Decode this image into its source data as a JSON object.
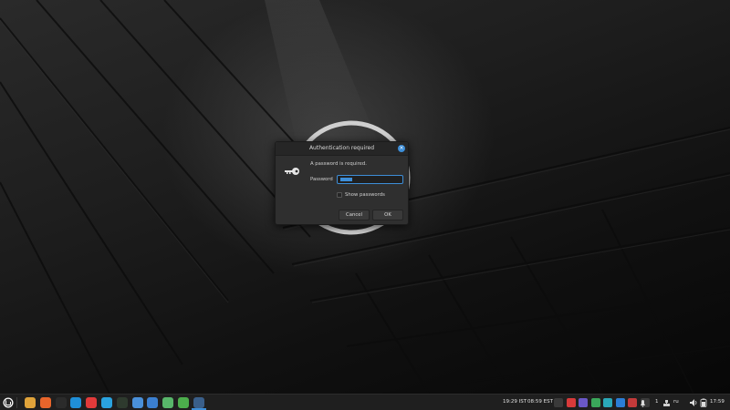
{
  "dialog": {
    "title": "Authentication required",
    "close_icon": "close-icon",
    "prompt": "A password is required.",
    "password_label": "Password",
    "password_value": "••••••",
    "show_passwords_label": "Show passwords",
    "cancel_label": "Cancel",
    "ok_label": "OK",
    "key_icon": "key-icon"
  },
  "taskbar": {
    "menu_icon": "linux-mint-menu-icon",
    "launchers": [
      {
        "name": "files-icon",
        "color": "#e0a33a"
      },
      {
        "name": "firefox-icon",
        "color": "#e8652b"
      },
      {
        "name": "terminal-icon",
        "color": "#2b2b2b"
      },
      {
        "name": "skype-icon",
        "color": "#1f8fd8"
      },
      {
        "name": "anydesk-icon",
        "color": "#e23a3a"
      },
      {
        "name": "telegram-icon",
        "color": "#2aa3df"
      },
      {
        "name": "system-monitor-icon",
        "color": "#2e3a2e"
      },
      {
        "name": "mail-icon",
        "color": "#4a90d9"
      },
      {
        "name": "phone-icon",
        "color": "#3b7fd0"
      },
      {
        "name": "vpn-icon",
        "color": "#58b66a"
      },
      {
        "name": "tool-icon",
        "color": "#4cae4c"
      },
      {
        "name": "network-icon",
        "color": "#3a5f8a"
      }
    ],
    "clock_secondary": "19:29 IST",
    "clock_tertiary": "08:59 EST",
    "tray_icons": [
      {
        "name": "clipboard-icon",
        "color": "#3a3a3a"
      },
      {
        "name": "anydesk-tray-icon",
        "color": "#d83a3a"
      },
      {
        "name": "teams-tray-icon",
        "color": "#6a58c8"
      },
      {
        "name": "check-tray-icon",
        "color": "#3aa75a"
      },
      {
        "name": "sync-tray-icon",
        "color": "#2aa8b8"
      },
      {
        "name": "teamviewer-tray-icon",
        "color": "#2b7ed6"
      },
      {
        "name": "phone-tray-icon",
        "color": "#c33a3a"
      },
      {
        "name": "share-tray-icon",
        "color": "#3a3a3a"
      }
    ],
    "notification_count": "1",
    "keyboard_layout": "ru",
    "clock": "17:59"
  }
}
